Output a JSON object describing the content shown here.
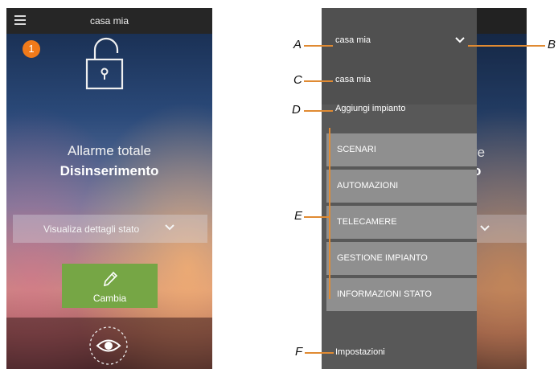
{
  "left_screen": {
    "header_title": "casa mia",
    "badge_number": "1",
    "state_title": "Allarme totale",
    "state_subtitle": "Disinserimento",
    "status_dropdown_label": "Visualiza dettagli stato",
    "change_button_label": "Cambia",
    "icons": [
      "menu-icon",
      "unlocked-padlock-icon",
      "chevron-down-icon",
      "pencil-icon",
      "eye-icon"
    ]
  },
  "right_screen": {
    "background_texts": [
      "re",
      "o"
    ],
    "drawer": {
      "selected_home": "casa mia",
      "home_entry": "casa mia",
      "add_system": "Aggiungi impianto",
      "items": [
        {
          "label": "SCENARI"
        },
        {
          "label": "AUTOMAZIONI"
        },
        {
          "label": "TELECAMERE"
        },
        {
          "label": "GESTIONE IMPIANTO"
        },
        {
          "label": "INFORMAZIONI STATO"
        }
      ],
      "settings": "Impostazioni"
    }
  },
  "callouts": {
    "A": "A",
    "B": "B",
    "C": "C",
    "D": "D",
    "E": "E",
    "F": "F"
  },
  "colors": {
    "accent_orange": "#f07a1a",
    "callout_line": "#e08a32",
    "change_button": "#76a645",
    "drawer_bg": "#585858",
    "menu_item_bg": "#8f8f8f"
  }
}
